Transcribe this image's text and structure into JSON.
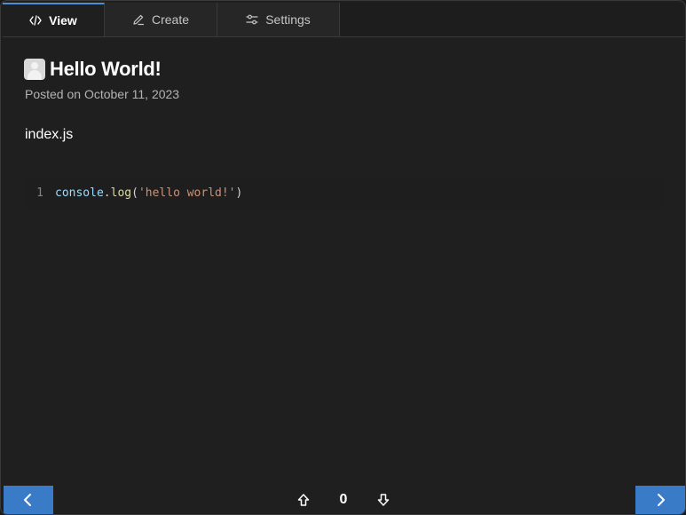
{
  "tabs": [
    {
      "label": "View",
      "icon": "code-icon",
      "active": true
    },
    {
      "label": "Create",
      "icon": "pencil-icon",
      "active": false
    },
    {
      "label": "Settings",
      "icon": "sliders-icon",
      "active": false
    }
  ],
  "post": {
    "title": "Hello World!",
    "posted": "Posted on October 11, 2023",
    "filename": "index.js"
  },
  "code": {
    "line_number": "1",
    "tokens": {
      "object": "console",
      "dot": ".",
      "method": "log",
      "open": "(",
      "string": "'hello world!'",
      "close": ")"
    }
  },
  "pager": {
    "count": "0"
  },
  "colors": {
    "accent": "#3a7bc8",
    "tab_active_border": "#4a8fd6",
    "background": "#1f1f1f"
  }
}
